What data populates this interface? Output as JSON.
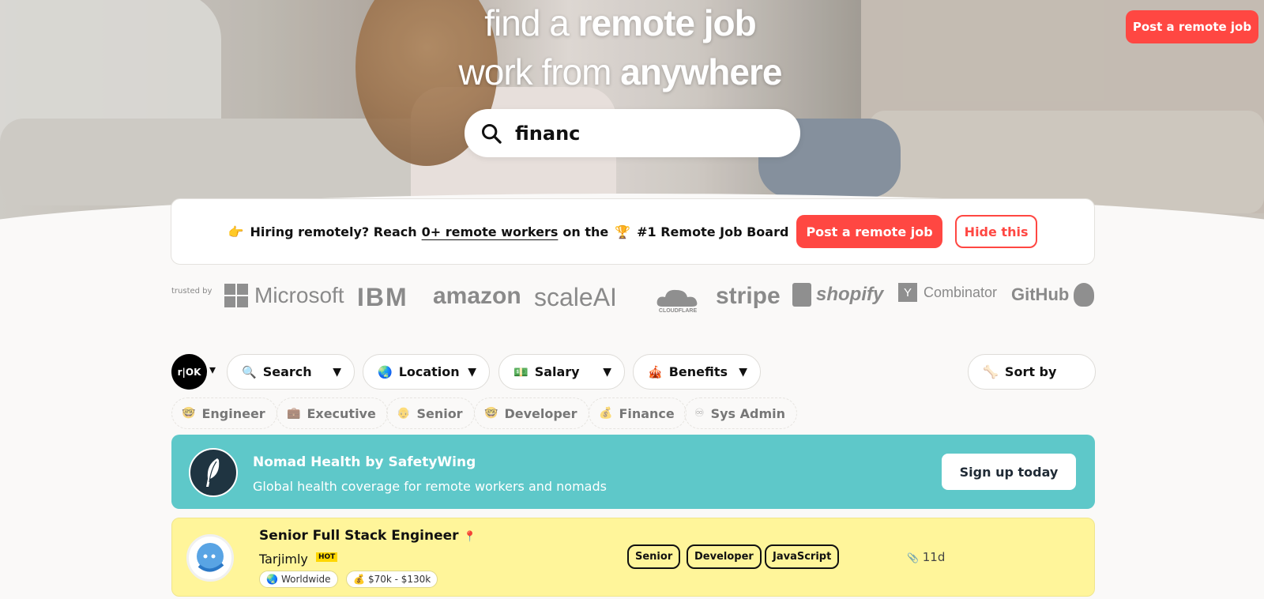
{
  "hero": {
    "line1_light": "find a",
    "line1_bold": "remote job",
    "line2_light": "work from",
    "line2_bold": "anywhere",
    "search_value": "financ",
    "post_button": "Post a remote job"
  },
  "hiring_bar": {
    "emoji": "👉",
    "prefix": "Hiring remotely? Reach",
    "link": "0+ remote workers",
    "middle": "on the",
    "trophy": "🏆",
    "suffix": "#1 Remote Job Board",
    "post_button": "Post a remote job",
    "hide_button": "Hide this"
  },
  "trusted": {
    "label": "trusted by",
    "logos": [
      "Microsoft",
      "IBM",
      "amazon",
      "scaleAI",
      "CLOUDFLARE",
      "stripe",
      "shopify",
      "Combinator",
      "GitHub"
    ]
  },
  "filters": {
    "avatar_text": "r|OK",
    "items": [
      {
        "icon": "🔍",
        "label": "Search"
      },
      {
        "icon": "🌏",
        "label": "Location"
      },
      {
        "icon": "💵",
        "label": "Salary"
      },
      {
        "icon": "🎪",
        "label": "Benefits"
      }
    ],
    "sort_label": "Sort by"
  },
  "tags": [
    {
      "icon": "🤓",
      "label": "Engineer"
    },
    {
      "icon": "💼",
      "label": "Executive"
    },
    {
      "icon": "👴",
      "label": "Senior"
    },
    {
      "icon": "🤓",
      "label": "Developer"
    },
    {
      "icon": "💰",
      "label": "Finance"
    },
    {
      "icon": "♾",
      "label": "Sys Admin"
    }
  ],
  "promo": {
    "title": "Nomad Health by SafetyWing",
    "subtitle": "Global health coverage for remote workers and nomads",
    "cta": "Sign up today",
    "bg_color": "#5ec8c9"
  },
  "job": {
    "title": "Senior Full Stack Engineer",
    "title_icon": "📍",
    "company": "Tarjimly",
    "hot_badge": "HOT",
    "location": "Worldwide",
    "location_icon": "🌏",
    "salary": "$70k - $130k",
    "salary_icon": "💰",
    "skills": [
      "Senior",
      "Developer",
      "JavaScript"
    ],
    "age": "11d",
    "age_icon": "📎",
    "bg_color": "#fff59a"
  }
}
